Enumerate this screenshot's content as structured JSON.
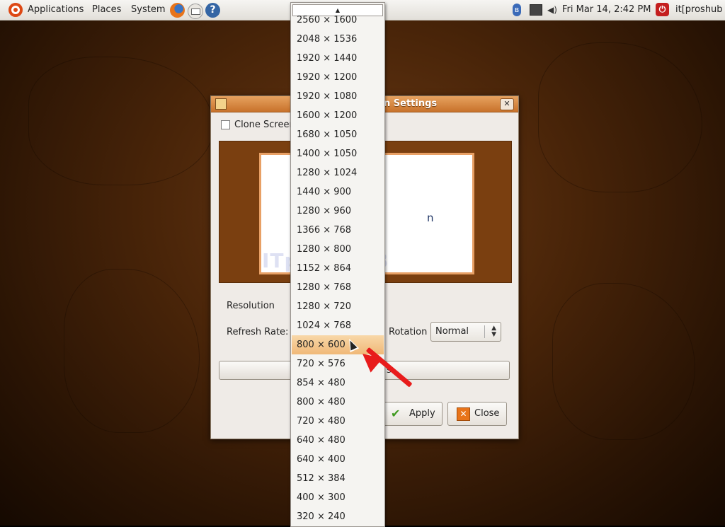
{
  "panel": {
    "menus": [
      "Applications",
      "Places",
      "System"
    ],
    "clock": "Fri Mar 14,  2:42 PM",
    "user": "it[proshub",
    "icons": [
      "ubuntu-logo-icon",
      "firefox-icon",
      "mail-icon",
      "help-icon",
      "bluetooth-icon",
      "network-icon",
      "volume-icon",
      "power-icon"
    ]
  },
  "dialog": {
    "title": "n Settings",
    "clone_label": "Clone Screen",
    "preview_text": "n",
    "watermark": "ITproSHUB",
    "resolution_label": "Resolution",
    "refresh_label": "Refresh Rate:",
    "rotation_label": "Rotation",
    "rotation_value": "Normal",
    "bigbar_text": "s",
    "apply_label": "Apply",
    "close_label": "Close"
  },
  "dropdown": {
    "options": [
      "2560 × 1600",
      "2048 × 1536",
      "1920 × 1440",
      "1920 × 1200",
      "1920 × 1080",
      "1600 × 1200",
      "1680 × 1050",
      "1400 × 1050",
      "1280 × 1024",
      "1440 × 900",
      "1280 × 960",
      "1366 × 768",
      "1280 × 800",
      "1152 × 864",
      "1280 × 768",
      "1280 × 720",
      "1024 × 768",
      "800 × 600",
      "720 × 576",
      "854 × 480",
      "800 × 480",
      "720 × 480",
      "640 × 480",
      "640 × 400",
      "512 × 384",
      "400 × 300",
      "320 × 240"
    ],
    "selected": "800 × 600"
  },
  "colors": {
    "titlebar": "#d78a45",
    "selection": "#f3c48a",
    "annotation_arrow": "#e81b1b"
  }
}
